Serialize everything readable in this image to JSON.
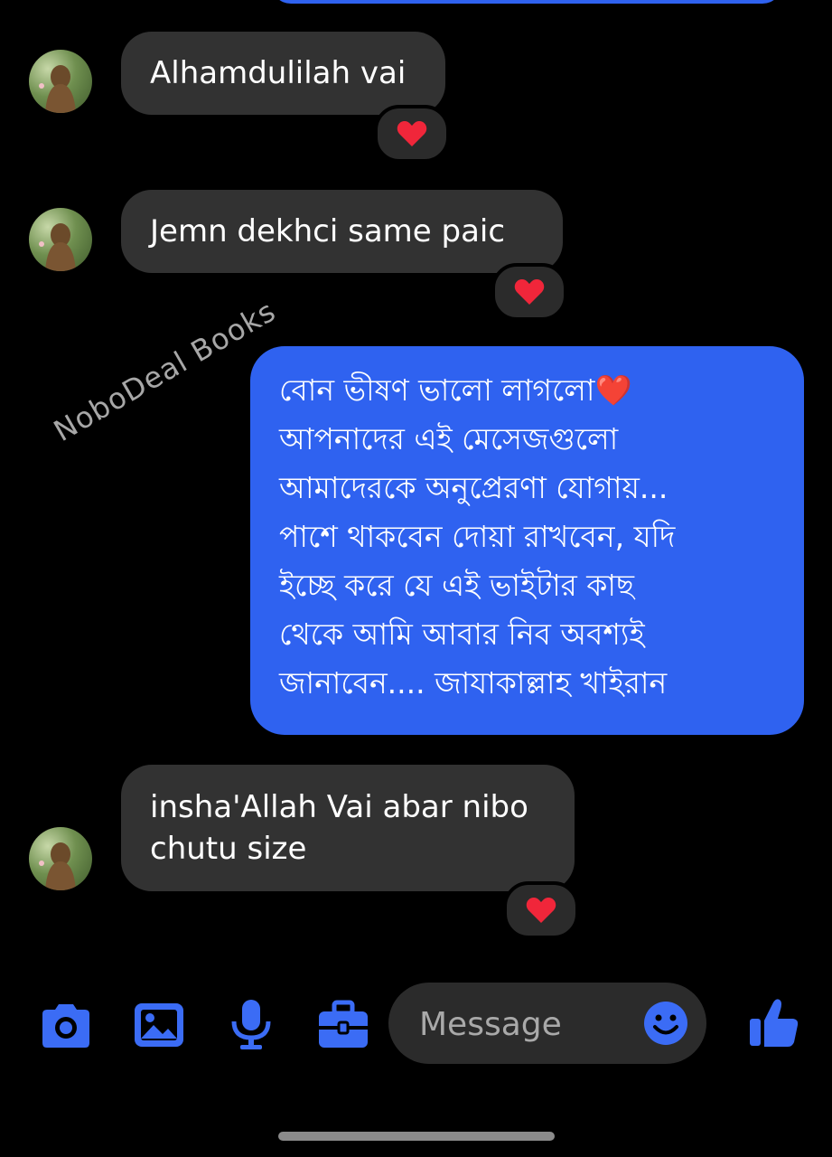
{
  "messages": [
    {
      "text": "Alhamdulilah vai",
      "reaction": "heart"
    },
    {
      "text": "Jemn dekhci same paic",
      "reaction": "heart"
    },
    {
      "text": "বোন ভীষণ ভালো লাগলো❤️\nআপনাদের এই মেসেজগুলো\nআমাদেরকে অনুপ্রেরণা যোগায়...\nপাশে থাকবেন দোয়া রাখবেন, যদি\nইচ্ছে করে যে এই ভাইটার কাছ\nথেকে আমি আবার নিব অবশ্যই\nজানাবেন.... জাযাকাল্লাহ খাইরান"
    },
    {
      "text": "insha'Allah Vai abar nibo\nchutu size",
      "reaction": "heart"
    }
  ],
  "watermark": "NoboDeal Books",
  "composer": {
    "placeholder": "Message",
    "icons": [
      "camera-icon",
      "image-icon",
      "microphone-icon",
      "briefcase-icon",
      "emoji-icon",
      "thumbs-up-icon"
    ]
  },
  "colors": {
    "accent": "#2f62f0",
    "bubble_in": "#323232",
    "background": "#000000",
    "heart": "#f0263a"
  }
}
